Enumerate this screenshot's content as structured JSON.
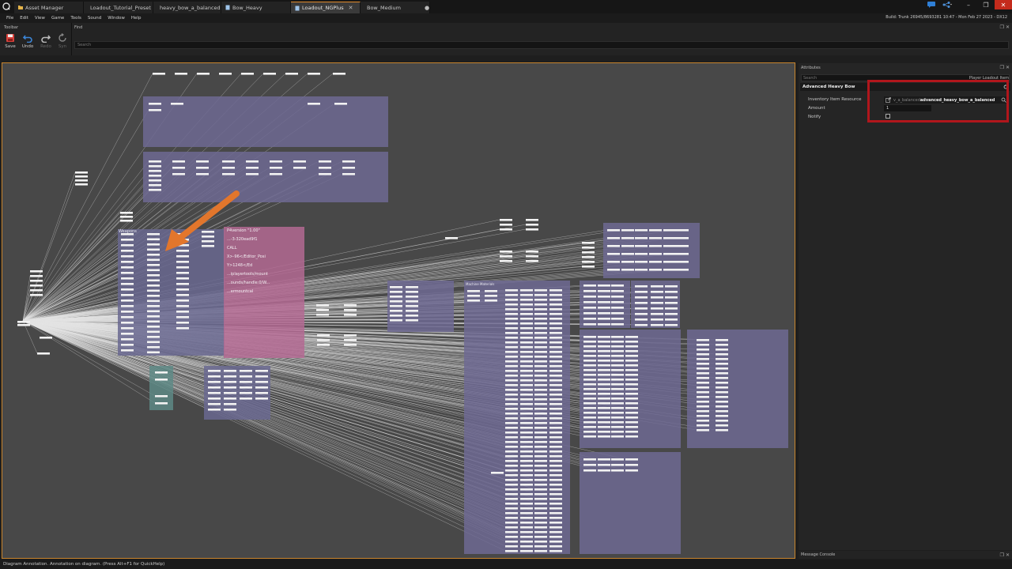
{
  "tabs": [
    {
      "label": "Asset Manager",
      "icon": "folder-icon",
      "active": false
    },
    {
      "label": "Loadout_Tutorial_Preset",
      "icon": "document-icon",
      "active": false
    },
    {
      "label": "heavy_bow_a_balanced",
      "icon": "document-icon",
      "active": false
    },
    {
      "label": "Bow_Heavy",
      "icon": "document-icon",
      "active": false
    },
    {
      "label": "Loadout_NGPlus",
      "icon": "document-icon",
      "active": true
    },
    {
      "label": "Bow_Medium",
      "icon": "document-icon",
      "active": false
    }
  ],
  "menu": [
    "File",
    "Edit",
    "View",
    "Game",
    "Tools",
    "Sound",
    "Window",
    "Help"
  ],
  "build_info": "Build: Trunk 26945/8693281 10:47 - Mon Feb 27 2023 - DX12",
  "toolbar": {
    "title": "Toolbar",
    "buttons": [
      {
        "label": "Save",
        "icon": "save-icon",
        "enabled": true
      },
      {
        "label": "Undo",
        "icon": "undo-icon",
        "enabled": true
      },
      {
        "label": "Redo",
        "icon": "redo-icon",
        "enabled": false
      },
      {
        "label": "Syn",
        "icon": "sync-icon",
        "enabled": false
      }
    ]
  },
  "find": {
    "title": "Find",
    "placeholder": "Search"
  },
  "diagram": {
    "groups": [
      {
        "label": "Weapons"
      },
      {
        "label": "Machine Materials"
      }
    ],
    "comment_lines": [
      "P4version \"1.00\"",
      "...-3-320ead9f1",
      "CALL",
      "X>-96</Editor_Posi",
      "Y>1248</Ed",
      "...iplayertools/mount",
      "...ounds/handle:0/W...",
      "...ermountcal"
    ],
    "accent": "#e2762c"
  },
  "attributes": {
    "title": "Attributes",
    "search_placeholder": "Search",
    "type_label": "Player Loadout Item",
    "object_name": "Advanced Heavy Bow",
    "fields": {
      "inventory_label": "Inventory Item Resource",
      "inventory_prefix": "v_a_balanced",
      "inventory_value": "advanced_heavy_bow_a_balanced",
      "amount_label": "Amount",
      "amount_value": "1",
      "notify_label": "Notify"
    },
    "highlight_color": "#b1161c"
  },
  "console": {
    "title": "Message Console"
  },
  "status": "Diagram Annotation. Annotation on diagram. (Press Alt+F1 for QuickHelp)"
}
